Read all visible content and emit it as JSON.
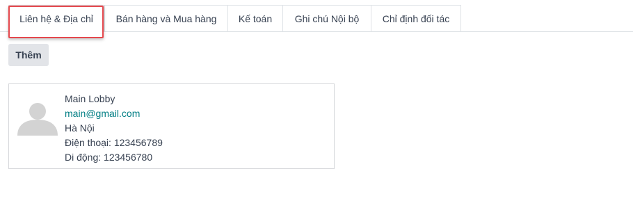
{
  "tabs": [
    {
      "label": "Liên hệ & Địa chỉ",
      "active": true
    },
    {
      "label": "Bán hàng và Mua hàng",
      "active": false
    },
    {
      "label": "Kế toán",
      "active": false
    },
    {
      "label": "Ghi chú Nội bộ",
      "active": false
    },
    {
      "label": "Chỉ định đối tác",
      "active": false
    }
  ],
  "actions": {
    "add_label": "Thêm"
  },
  "contact_card": {
    "avatar_icon": "user-placeholder-icon",
    "name": "Main Lobby",
    "email": "main@gmail.com",
    "city": "Hà Nội",
    "phone": "Điện thoại: 123456789",
    "mobile": "Di động: 123456780"
  },
  "colors": {
    "highlight": "#e5484d",
    "link": "#017e84",
    "button_bg": "#e2e4e8"
  }
}
